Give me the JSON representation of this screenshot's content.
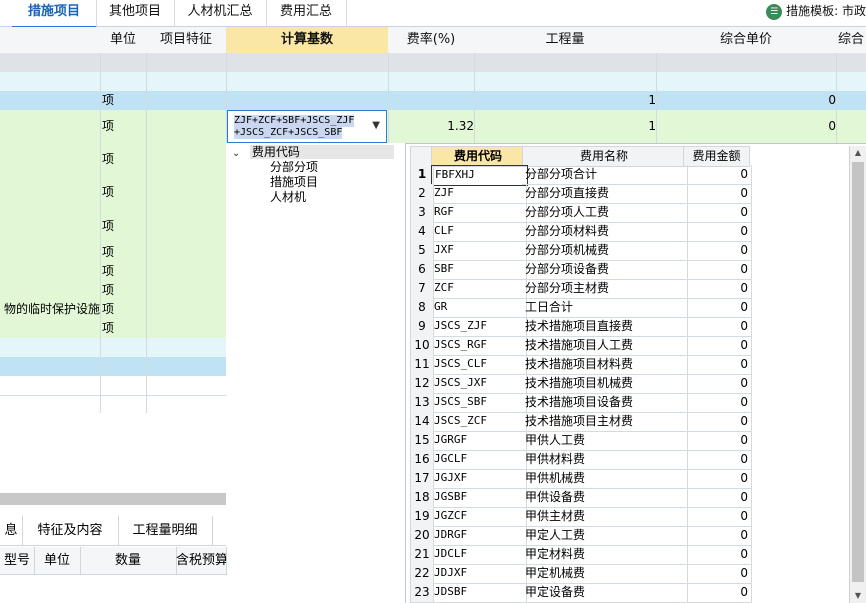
{
  "tabs": [
    "措施项目",
    "其他项目",
    "人材机汇总",
    "费用汇总"
  ],
  "template_label": "措施模板: 市政",
  "template_icon": "template-icon",
  "grid": {
    "headers": [
      "单位",
      "项目特征",
      "计算基数",
      "费率(%)",
      "工程量",
      "综合单价",
      "综合"
    ],
    "rows": [
      {
        "unit": "",
        "name": "",
        "qty": "",
        "price": ""
      },
      {
        "unit": "",
        "name": "",
        "qty": "",
        "price": ""
      },
      {
        "unit": "项",
        "name": "",
        "qty": "1",
        "price": "0"
      },
      {
        "unit": "项",
        "name": "",
        "qty": "1",
        "price": "0",
        "rate": "1.32"
      },
      {
        "unit": "项",
        "name": "",
        "qty": "",
        "price": ""
      },
      {
        "unit": "项",
        "name": "",
        "qty": "",
        "price": ""
      },
      {
        "unit": "项",
        "name": "",
        "qty": "",
        "price": ""
      },
      {
        "unit": "项",
        "name": "",
        "qty": "",
        "price": ""
      },
      {
        "unit": "项",
        "name": "",
        "qty": "",
        "price": ""
      },
      {
        "unit": "项",
        "name": "",
        "qty": "",
        "price": ""
      },
      {
        "unit": "项",
        "name": "物的临时保护设施",
        "qty": "",
        "price": ""
      },
      {
        "unit": "项",
        "name": "",
        "qty": "",
        "price": ""
      },
      {
        "unit": "",
        "name": "",
        "qty": "",
        "price": ""
      },
      {
        "unit": "",
        "name": "",
        "qty": "",
        "price": ""
      },
      {
        "unit": "",
        "name": "",
        "qty": "",
        "price": ""
      }
    ]
  },
  "formula": {
    "line1": "ZJF+ZCF+SBF+JSCS_ZJF",
    "line2": "+JSCS_ZCF+JSCS_SBF"
  },
  "tree": {
    "root": "费用代码",
    "children": [
      "分部分项",
      "措施项目",
      "人材机"
    ]
  },
  "code_table": {
    "headers": [
      "费用代码",
      "费用名称",
      "费用金额"
    ],
    "rows": [
      {
        "n": "1",
        "code": "FBFXHJ",
        "name": "分部分项合计",
        "amt": "0"
      },
      {
        "n": "2",
        "code": "ZJF",
        "name": "分部分项直接费",
        "amt": "0"
      },
      {
        "n": "3",
        "code": "RGF",
        "name": "分部分项人工费",
        "amt": "0"
      },
      {
        "n": "4",
        "code": "CLF",
        "name": "分部分项材料费",
        "amt": "0"
      },
      {
        "n": "5",
        "code": "JXF",
        "name": "分部分项机械费",
        "amt": "0"
      },
      {
        "n": "6",
        "code": "SBF",
        "name": "分部分项设备费",
        "amt": "0"
      },
      {
        "n": "7",
        "code": "ZCF",
        "name": "分部分项主材费",
        "amt": "0"
      },
      {
        "n": "8",
        "code": "GR",
        "name": "工日合计",
        "amt": "0"
      },
      {
        "n": "9",
        "code": "JSCS_ZJF",
        "name": "技术措施项目直接费",
        "amt": "0"
      },
      {
        "n": "10",
        "code": "JSCS_RGF",
        "name": "技术措施项目人工费",
        "amt": "0"
      },
      {
        "n": "11",
        "code": "JSCS_CLF",
        "name": "技术措施项目材料费",
        "amt": "0"
      },
      {
        "n": "12",
        "code": "JSCS_JXF",
        "name": "技术措施项目机械费",
        "amt": "0"
      },
      {
        "n": "13",
        "code": "JSCS_SBF",
        "name": "技术措施项目设备费",
        "amt": "0"
      },
      {
        "n": "14",
        "code": "JSCS_ZCF",
        "name": "技术措施项目主材费",
        "amt": "0"
      },
      {
        "n": "15",
        "code": "JGRGF",
        "name": "甲供人工费",
        "amt": "0"
      },
      {
        "n": "16",
        "code": "JGCLF",
        "name": "甲供材料费",
        "amt": "0"
      },
      {
        "n": "17",
        "code": "JGJXF",
        "name": "甲供机械费",
        "amt": "0"
      },
      {
        "n": "18",
        "code": "JGSBF",
        "name": "甲供设备费",
        "amt": "0"
      },
      {
        "n": "19",
        "code": "JGZCF",
        "name": "甲供主材费",
        "amt": "0"
      },
      {
        "n": "20",
        "code": "JDRGF",
        "name": "甲定人工费",
        "amt": "0"
      },
      {
        "n": "21",
        "code": "JDCLF",
        "name": "甲定材料费",
        "amt": "0"
      },
      {
        "n": "22",
        "code": "JDJXF",
        "name": "甲定机械费",
        "amt": "0"
      },
      {
        "n": "23",
        "code": "JDSBF",
        "name": "甲定设备费",
        "amt": "0"
      }
    ]
  },
  "bottom": {
    "tabs": [
      "息",
      "特征及内容",
      "工程量明细"
    ],
    "headers": [
      "型号",
      "单位",
      "数量",
      "含税预算"
    ]
  }
}
